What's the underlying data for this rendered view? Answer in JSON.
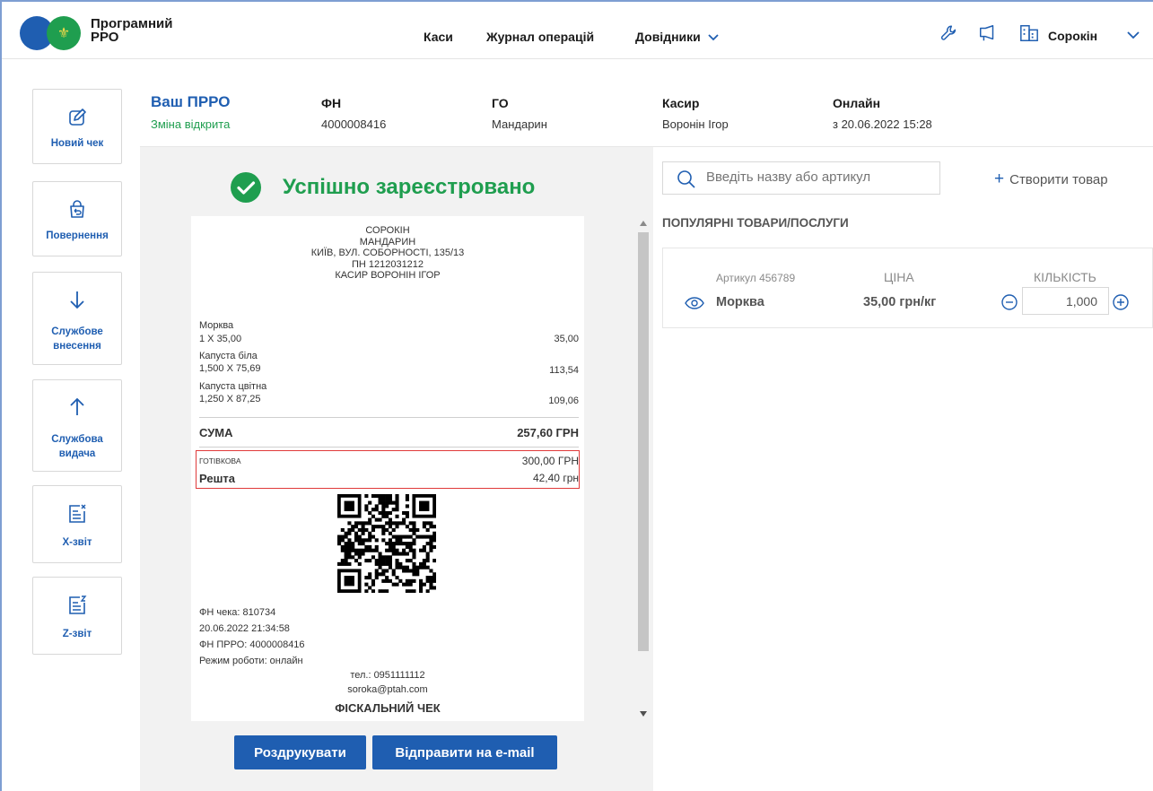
{
  "header": {
    "brand_line1": "Програмний",
    "brand_line2": "РРО",
    "nav": [
      "Каси",
      "Журнал операцій",
      "Довідники"
    ],
    "user": "Сорокін"
  },
  "sidebar": {
    "items": [
      {
        "label": "Новий чек",
        "icon": "edit-icon"
      },
      {
        "label": "Повернення",
        "icon": "return-bag-icon"
      },
      {
        "label_line1": "Службове",
        "label_line2": "внесення",
        "icon": "arrow-down-icon"
      },
      {
        "label_line1": "Службова",
        "label_line2": "видача",
        "icon": "arrow-up-icon"
      },
      {
        "label": "Х-звіт",
        "icon": "x-report-icon"
      },
      {
        "label": "Z-звіт",
        "icon": "z-report-icon"
      }
    ]
  },
  "info": {
    "prro_title": "Ваш ПРРО",
    "prro_status": "Зміна відкрита",
    "fn_title": "ФН",
    "fn_value": "4000008416",
    "go_title": "ГО",
    "go_value": "Мандарин",
    "cashier_title": "Касир",
    "cashier_value": "Воронін Ігор",
    "online_title": "Онлайн",
    "online_value": "з 20.06.2022 15:28"
  },
  "success_message": "Успішно зареєстровано",
  "receipt": {
    "header_lines": [
      "СОРОКІН",
      "МАНДАРИН",
      "КИЇВ, ВУЛ. СОБОРНОСТІ, 135/13",
      "ПН 1212031212",
      "КАСИР ВОРОНІН ІГОР"
    ],
    "items": [
      {
        "name": "Морква",
        "qty": "1 X 35,00",
        "sum": "35,00"
      },
      {
        "name": "Капуста біла",
        "qty": "1,500 X 75,69",
        "sum": "113,54"
      },
      {
        "name": "Капуста цвітна",
        "qty": "1,250 X 87,25",
        "sum": "109,06"
      }
    ],
    "total_label": "СУМА",
    "total_value": "257,60 ГРН",
    "cash_label": "ГОТІВКОВА",
    "cash_value": "300,00 ГРН",
    "change_label": "Решта",
    "change_value": "42,40 грн",
    "footer_lines": [
      "ФН чека: 810734",
      "20.06.2022 21:34:58",
      "ФН ПРРО: 4000008416",
      "Режим роботи: онлайн"
    ],
    "phone": "тел.: 0951111112",
    "email": "soroka@ptah.com",
    "fiscal_label": "ФІСКАЛЬНИЙ ЧЕК"
  },
  "buttons": {
    "print": "Роздрукувати",
    "email": "Відправити на e-mail"
  },
  "right": {
    "search_placeholder": "Введіть назву або артикул",
    "create_label": "Створити товар",
    "popular_title": "ПОПУЛЯРНІ ТОВАРИ/ПОСЛУГИ",
    "product": {
      "article": "Артикул 456789",
      "name": "Морква",
      "price_header": "ЦІНА",
      "price": "35,00 грн/кг",
      "qty_header": "КІЛЬКІСТЬ",
      "qty": "1,000"
    }
  },
  "colors": {
    "brand_blue": "#1f5eb1",
    "success_green": "#1f9e4f",
    "highlight_red": "#e03a3a"
  }
}
